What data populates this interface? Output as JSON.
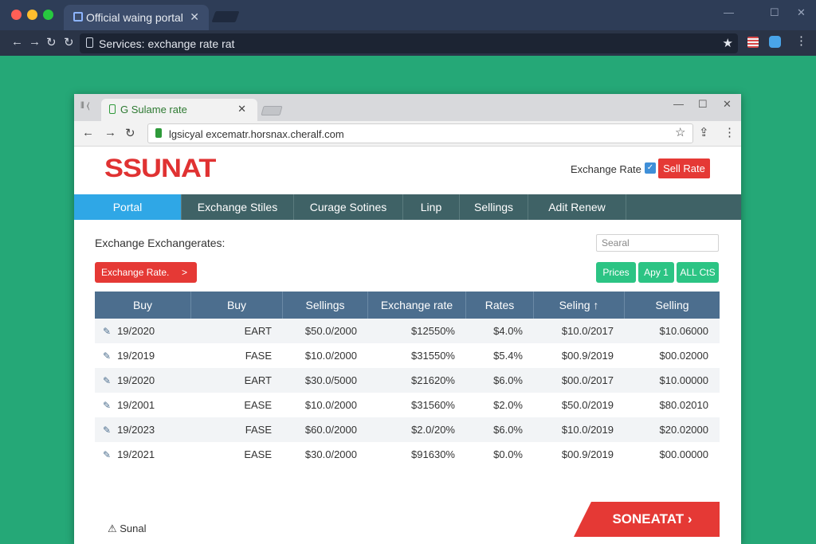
{
  "outer_browser": {
    "tab_title": "Official waing portal",
    "tab_close": "✕",
    "address": "Services: exchange rate rat",
    "window_controls": [
      "—",
      "☐",
      "✕"
    ]
  },
  "inner_browser": {
    "tab_title": "G Sulame rate",
    "tab_close": "✕",
    "address": "lgsicyal excematr.horsnax.cheralf.com",
    "window_controls": [
      "—",
      "☐",
      "✕"
    ]
  },
  "header": {
    "logo_text": "SSUNAT",
    "exchange_label": "Exchange Rate",
    "checkbox_mark": "✓",
    "sell_button": "Sell Rate"
  },
  "nav": {
    "items": [
      {
        "label": "Portal",
        "active": true
      },
      {
        "label": "Exchange Stiles",
        "active": false
      },
      {
        "label": "Curage Sotines",
        "active": false
      },
      {
        "label": "Linp",
        "active": false
      },
      {
        "label": "Sellings",
        "active": false
      },
      {
        "label": "Adit Renew",
        "active": false
      }
    ]
  },
  "content": {
    "section_title": "Exchange Exchangerates:",
    "search_placeholder": "Searal",
    "exchange_button": "Exchange Rate.",
    "exchange_button_chevron": ">",
    "filter_buttons": [
      "Prices",
      "Apy 1",
      "ALL CtS"
    ]
  },
  "table": {
    "headers": [
      "Buy",
      "Buy",
      "Sellings",
      "Exchange rate",
      "Rates",
      "Seling ↑",
      "Selling"
    ],
    "rows": [
      [
        "19/2020",
        "EART",
        "$50.0/2000",
        "$12550%",
        "$4.0%",
        "$10.0/2017",
        "$10.06000"
      ],
      [
        "19/2019",
        "FASE",
        "$10.0/2000",
        "$31550%",
        "$5.4%",
        "$00.9/2019",
        "$00.02000"
      ],
      [
        "19/2020",
        "EART",
        "$30.0/5000",
        "$21620%",
        "$6.0%",
        "$00.0/2017",
        "$10.00000"
      ],
      [
        "19/2001",
        "EASE",
        "$10.0/2000",
        "$31560%",
        "$2.0%",
        "$50.0/2019",
        "$80.02010"
      ],
      [
        "19/2023",
        "FASE",
        "$60.0/2000",
        "$2.0/20%",
        "$6.0%",
        "$10.0/2019",
        "$20.02000"
      ],
      [
        "19/2021",
        "EASE",
        "$30.0/2000",
        "$91630%",
        "$0.0%",
        "$00.9/2019",
        "$00.00000"
      ]
    ]
  },
  "footer": {
    "label": "⚠ Sunal",
    "button": "SONEATAT ›"
  },
  "colors": {
    "background_green": "#25a877",
    "brand_red": "#e53935",
    "nav_teal": "#3f6266",
    "nav_active": "#2fa7e6",
    "table_header": "#4c6e8e",
    "filter_green": "#2cc484"
  }
}
